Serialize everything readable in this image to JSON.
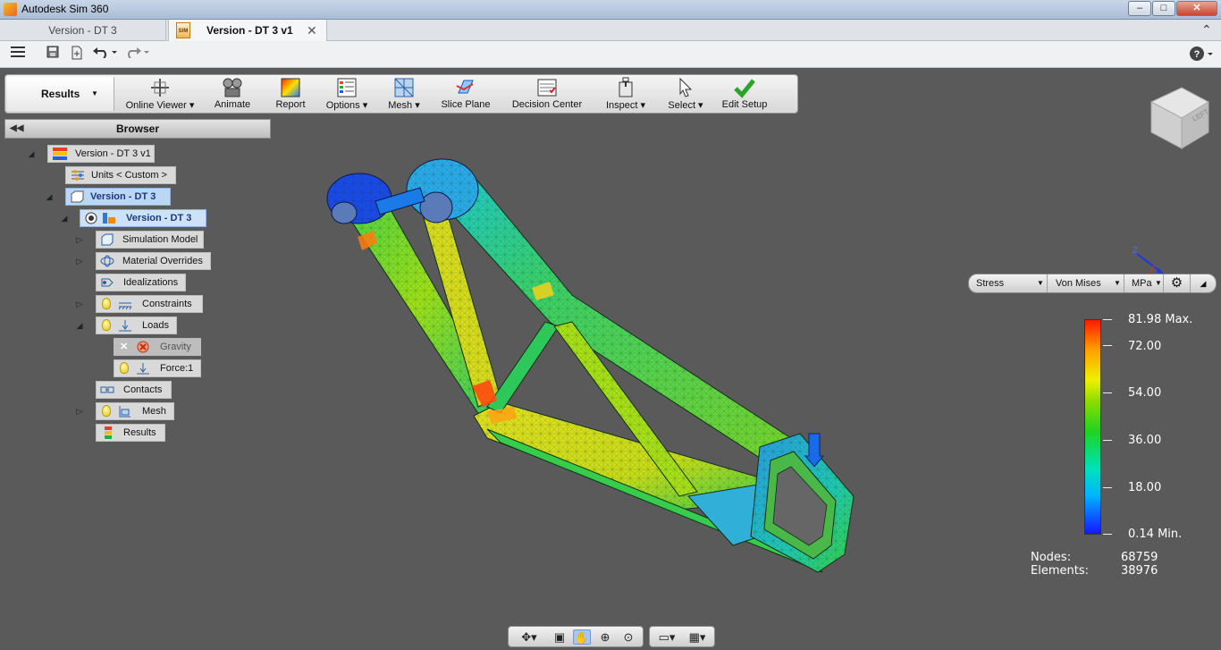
{
  "window": {
    "title": "Autodesk Sim 360",
    "controls": {
      "minimize": "–",
      "maximize": "□",
      "close": "✕"
    }
  },
  "tabs": [
    {
      "label": "Version - DT 3",
      "active": false
    },
    {
      "label": "Version - DT 3 v1",
      "active": true,
      "icon_text": "SIM"
    }
  ],
  "quick_access": {
    "icons": [
      "menu-icon",
      "save-icon",
      "export-icon",
      "undo-icon",
      "redo-icon",
      "help-icon"
    ]
  },
  "ribbon": {
    "tab_label": "Results",
    "buttons": [
      {
        "label": "Online Viewer",
        "dropdown": true
      },
      {
        "label": "Animate"
      },
      {
        "label": "Report"
      },
      {
        "label": "Options",
        "dropdown": true
      },
      {
        "label": "Mesh",
        "dropdown": true
      },
      {
        "label": "Slice Plane"
      },
      {
        "label": "Decision Center"
      },
      {
        "label": "Inspect",
        "dropdown": true
      },
      {
        "label": "Select",
        "dropdown": true
      },
      {
        "label": "Edit Setup"
      }
    ]
  },
  "browser": {
    "title": "Browser",
    "nodes": [
      {
        "label": "Version - DT 3 v1"
      },
      {
        "label": "Units < Custom >"
      },
      {
        "label": "Version - DT 3"
      },
      {
        "label": "Version - DT 3"
      },
      {
        "label": "Simulation Model"
      },
      {
        "label": "Material Overrides"
      },
      {
        "label": "Idealizations"
      },
      {
        "label": "Constraints"
      },
      {
        "label": "Loads"
      },
      {
        "label": "Gravity"
      },
      {
        "label": "Force:1"
      },
      {
        "label": "Contacts"
      },
      {
        "label": "Mesh"
      },
      {
        "label": "Results"
      }
    ]
  },
  "viewcube": {
    "face_label": "LEFT"
  },
  "triad": {
    "z_label": "Z",
    "x_label": "X"
  },
  "result_selectors": {
    "result_type": "Stress",
    "component": "Von Mises",
    "units": "MPa"
  },
  "legend": {
    "labels": [
      "81.98 Max.",
      "72.00",
      "54.00",
      "36.00",
      "18.00",
      "0.14 Min."
    ],
    "max": 81.98,
    "min": 0.14
  },
  "stats": {
    "nodes_label": "Nodes:",
    "nodes_value": "68759",
    "elements_label": "Elements:",
    "elements_value": "38976"
  },
  "nav_bar": {
    "icons": [
      "orbit-icon",
      "look-at-icon",
      "pan-icon",
      "zoom-icon",
      "zoom-fit-icon",
      "display-icon",
      "grid-icon"
    ],
    "active": "pan-icon"
  }
}
